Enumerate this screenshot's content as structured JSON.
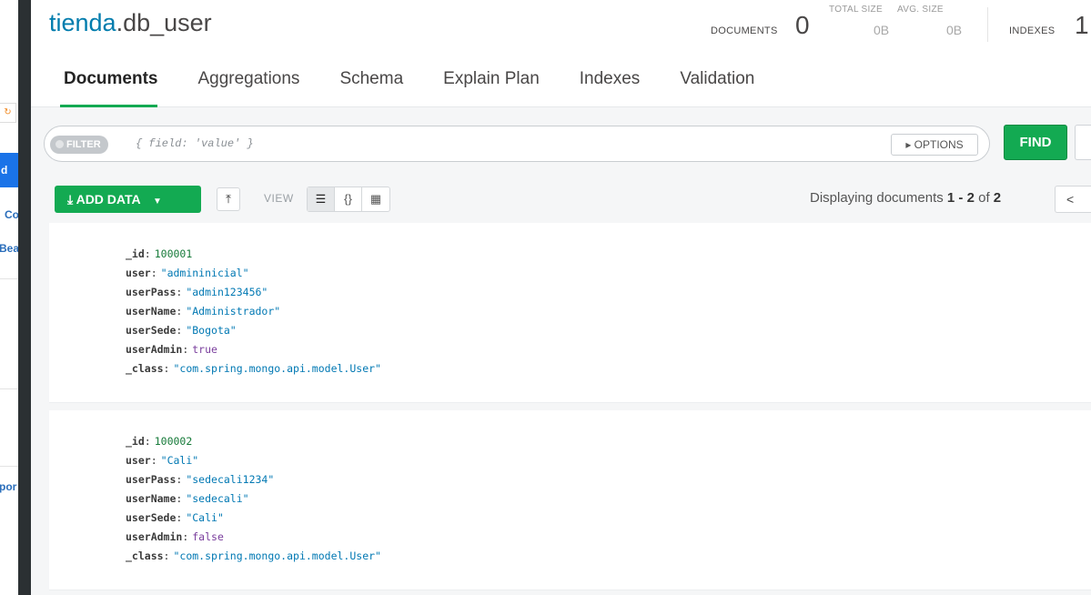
{
  "header": {
    "db": "tienda",
    "collection": ".db_user",
    "stats": {
      "documents_label": "DOCUMENTS",
      "documents_value": "0",
      "total_size_label": "TOTAL SIZE",
      "total_size_value": "0B",
      "avg_size_label": "AVG. SIZE",
      "avg_size_value": "0B",
      "indexes_label": "INDEXES",
      "indexes_value": "1"
    }
  },
  "tabs": [
    "Documents",
    "Aggregations",
    "Schema",
    "Explain Plan",
    "Indexes",
    "Validation"
  ],
  "active_tab": "Documents",
  "query": {
    "filter_label": "FILTER",
    "filter_placeholder": "{ field: 'value' }",
    "options_label": "▸ OPTIONS",
    "find_label": "FIND"
  },
  "toolbar": {
    "add_data_label": "ADD DATA",
    "view_label": "VIEW",
    "paging": {
      "prefix": "Displaying documents ",
      "range": "1 - 2",
      "of": " of ",
      "total": "2"
    },
    "prev_label": "<"
  },
  "sidebar": {
    "items": [
      "d",
      "Co",
      "Bea",
      "por"
    ]
  },
  "documents": [
    [
      {
        "key": "_id",
        "value": "100001"
      },
      {
        "key": "user",
        "value": "\"admininicial\""
      },
      {
        "key": "userPass",
        "value": "\"admin123456\""
      },
      {
        "key": "userName",
        "value": "\"Administrador\""
      },
      {
        "key": "userSede",
        "value": "\"Bogota\""
      },
      {
        "key": "userAdmin",
        "value": "true"
      },
      {
        "key": "_class",
        "value": "\"com.spring.mongo.api.model.User\""
      }
    ],
    [
      {
        "key": "_id",
        "value": "100002"
      },
      {
        "key": "user",
        "value": "\"Cali\""
      },
      {
        "key": "userPass",
        "value": "\"sedecali1234\""
      },
      {
        "key": "userName",
        "value": "\"sedecali\""
      },
      {
        "key": "userSede",
        "value": "\"Cali\""
      },
      {
        "key": "userAdmin",
        "value": "false"
      },
      {
        "key": "_class",
        "value": "\"com.spring.mongo.api.model.User\""
      }
    ]
  ],
  "colors": {
    "accent_green": "#13aa52",
    "db_blue": "#007cad",
    "string_value": "#0078b3",
    "number_value": "#167a39",
    "boolean_value": "#7a3e9d"
  }
}
